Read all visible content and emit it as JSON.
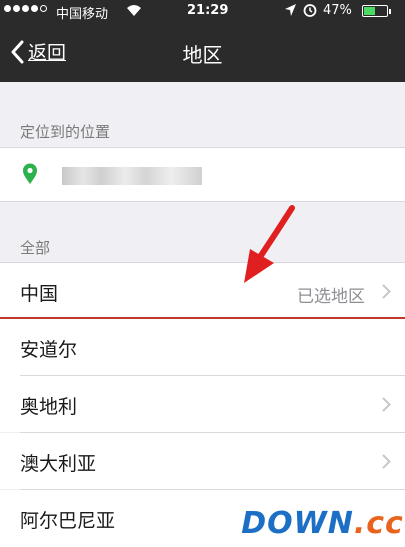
{
  "status_bar": {
    "carrier": "中国移动",
    "time": "21:29",
    "battery_percent": "47%",
    "signal_dots_filled": 4,
    "battery_level": 0.47,
    "icons": [
      "signal-dots-icon",
      "wifi-icon",
      "location-arrow-icon",
      "alarm-icon",
      "battery-icon"
    ]
  },
  "nav": {
    "back_label": "返回",
    "title": "地区"
  },
  "located_section": {
    "header": "定位到的位置",
    "location_value": "(blurred)"
  },
  "all_section": {
    "header": "全部",
    "items": [
      {
        "label": "中国",
        "detail": "已选地区",
        "has_chevron": true
      },
      {
        "label": "安道尔",
        "detail": "",
        "has_chevron": false
      },
      {
        "label": "奥地利",
        "detail": "",
        "has_chevron": true
      },
      {
        "label": "澳大利亚",
        "detail": "",
        "has_chevron": true
      },
      {
        "label": "阿尔巴尼亚",
        "detail": "",
        "has_chevron": false
      }
    ]
  },
  "annotation": {
    "arrow_color": "#e02020",
    "divider_color": "#c0392b"
  },
  "watermark": {
    "text_main": "DOWN",
    "text_accent": ".cc"
  },
  "colors": {
    "nav_background": "#2b2b2b",
    "pin_green": "#2bb24c",
    "battery_green": "#4cd964",
    "watermark_blue": "#1c6fc5",
    "watermark_orange": "#e8641e"
  }
}
